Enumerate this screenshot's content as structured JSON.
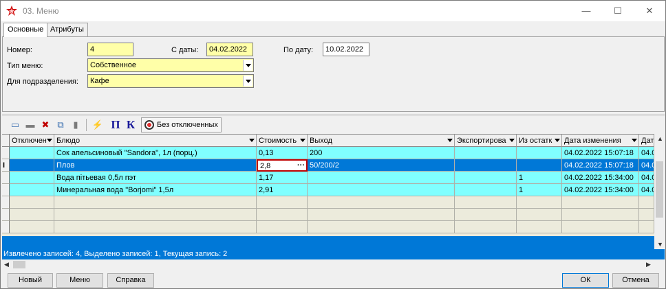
{
  "window": {
    "title": "03. Меню",
    "min": "—",
    "max": "☐",
    "close": "✕"
  },
  "tabs": [
    {
      "label": "Основные"
    },
    {
      "label": "Атрибуты"
    }
  ],
  "form": {
    "number_label": "Номер:",
    "number_value": "4",
    "from_label": "С даты:",
    "from_value": "04.02.2022",
    "to_label": "По дату:",
    "to_value": "10.02.2022",
    "menu_type_label": "Тип меню:",
    "menu_type_value": "Собственное",
    "division_label": "Для подразделения:",
    "division_value": "Кафе"
  },
  "toolbar": {
    "icons": [
      "folder-open-icon",
      "folder-icon",
      "delete-record-icon",
      "copy-record-icon",
      "document-icon",
      "lightning-icon",
      "pi-icon",
      "k-icon"
    ],
    "pi": "П",
    "k": "К",
    "filter_label": "Без отключенных"
  },
  "grid": {
    "columns": [
      "Отключен",
      "Блюдо",
      "Стоимость",
      "Выход",
      "Экспортирова",
      "Из остатк",
      "Дата изменения",
      "Дат"
    ],
    "rows": [
      {
        "off": "",
        "dish": "Сок апельсиновый \"Sandora\", 1л (порц.)",
        "cost": "0,13",
        "yield": "200",
        "exp": "",
        "stock": "",
        "date": "04.02.2022 15:07:18",
        "date2": "04.0"
      },
      {
        "off": "",
        "dish": "Плов",
        "cost": "2,8",
        "yield": "50/200/2",
        "exp": "",
        "stock": "",
        "date": "04.02.2022 15:07:18",
        "date2": "04.0"
      },
      {
        "off": "",
        "dish": "Вода пітьевая 0,5л пэт",
        "cost": "1,17",
        "yield": "",
        "exp": "",
        "stock": "1",
        "date": "04.02.2022 15:34:00",
        "date2": "04.0"
      },
      {
        "off": "",
        "dish": "Минеральная вода \"Borjomi\" 1,5л",
        "cost": "2,91",
        "yield": "",
        "exp": "",
        "stock": "1",
        "date": "04.02.2022 15:34:00",
        "date2": "04.0"
      }
    ],
    "current_row_marker": "I",
    "edit_ellipsis": "···"
  },
  "status": "Извлечено записей: 4, Выделено записей: 1, Текущая запись: 2",
  "buttons": {
    "new": "Новый",
    "menu": "Меню",
    "help": "Справка",
    "ok": "ОК",
    "cancel": "Отмена"
  },
  "colors": {
    "selection": "#0078d7",
    "row_highlight": "#80ffff",
    "required_field": "#ffffa8",
    "edit_border": "#c00000"
  }
}
